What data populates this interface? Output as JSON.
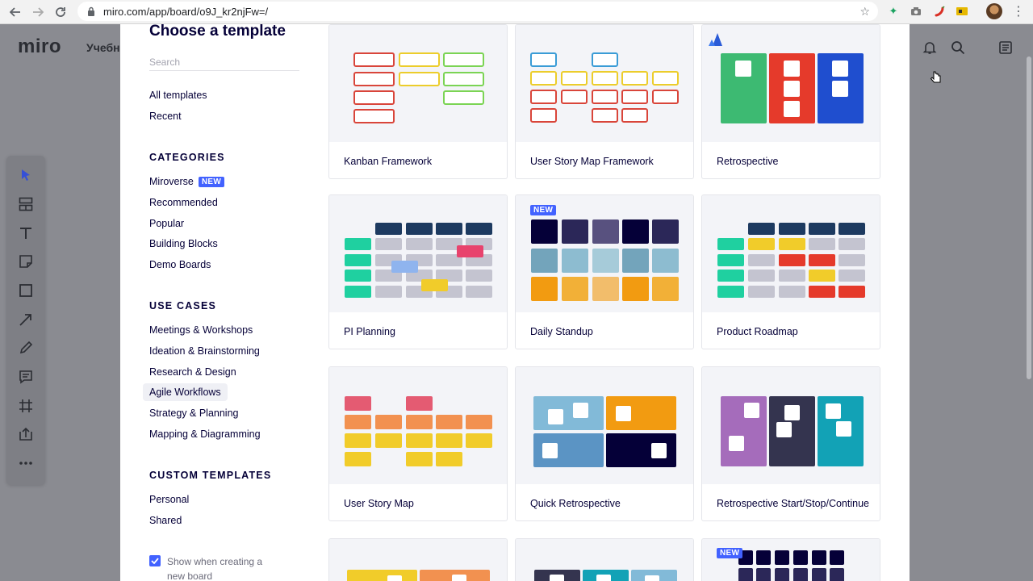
{
  "browser": {
    "url": "miro.com/app/board/o9J_kr2njFw=/"
  },
  "app": {
    "logo": "miro",
    "board_name": "Учебн"
  },
  "modal": {
    "title": "Choose a template",
    "search_placeholder": "Search",
    "nav": {
      "all_templates": "All templates",
      "recent": "Recent"
    },
    "categories": {
      "heading": "CATEGORIES",
      "items": [
        "Miroverse",
        "Recommended",
        "Popular",
        "Building Blocks",
        "Demo Boards"
      ],
      "new_badge": "NEW"
    },
    "use_cases": {
      "heading": "USE CASES",
      "items": [
        "Meetings & Workshops",
        "Ideation & Brainstorming",
        "Research & Design",
        "Agile Workflows",
        "Strategy & Planning",
        "Mapping & Diagramming"
      ],
      "active": "Agile Workflows"
    },
    "custom_templates": {
      "heading": "CUSTOM TEMPLATES",
      "items": [
        "Personal",
        "Shared"
      ]
    },
    "show_when_creating": {
      "checked": true,
      "label": "Show when creating a new board"
    },
    "templates": [
      {
        "name": "Kanban Framework"
      },
      {
        "name": "User Story Map Framework"
      },
      {
        "name": "Retrospective"
      },
      {
        "name": "PI Planning"
      },
      {
        "name": "Daily Standup",
        "badge": "NEW"
      },
      {
        "name": "Product Roadmap"
      },
      {
        "name": "User Story Map"
      },
      {
        "name": "Quick Retrospective"
      },
      {
        "name": "Retrospective Start/Stop/Continue"
      },
      {
        "name": ""
      },
      {
        "name": ""
      },
      {
        "name": "",
        "badge": "NEW"
      }
    ]
  },
  "colors": {
    "accent": "#4262ff",
    "navy": "#050038",
    "green": "#3dba72",
    "red": "#e53a2b",
    "blue": "#1f4ecf"
  },
  "icons": [
    "back-icon",
    "forward-icon",
    "reload-icon",
    "lock-icon",
    "star-icon",
    "bell-icon",
    "search-icon",
    "notes-icon",
    "cursor-icon",
    "atlassian-icon"
  ]
}
